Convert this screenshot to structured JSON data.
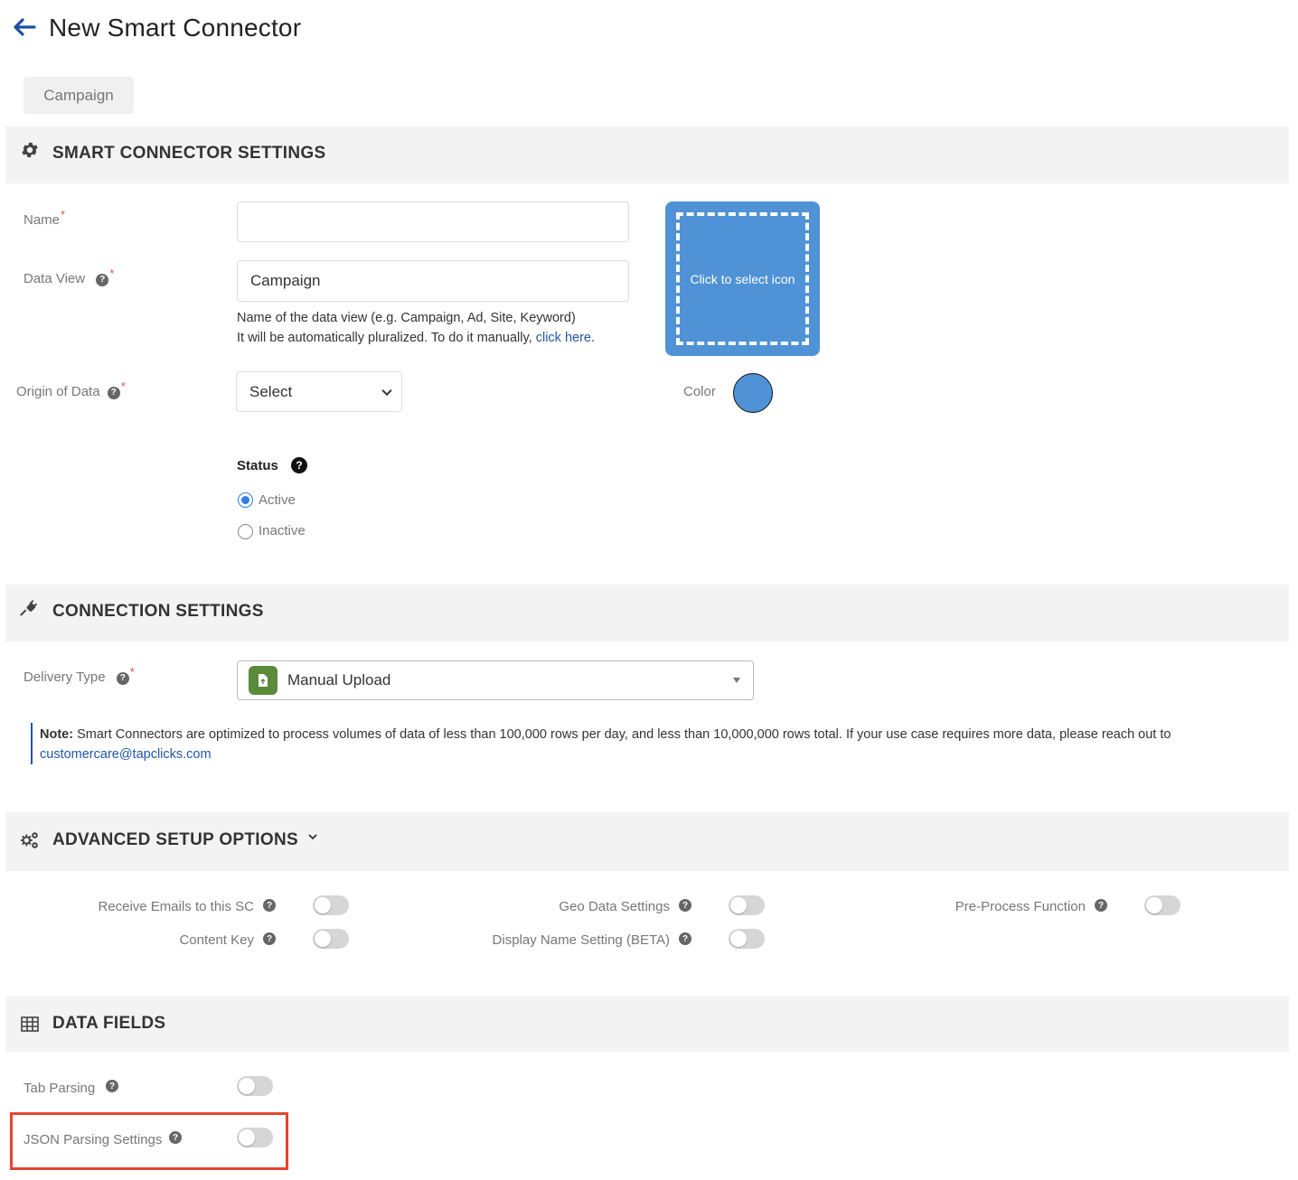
{
  "header": {
    "title": "New Smart Connector"
  },
  "tabs": [
    {
      "label": "Campaign"
    }
  ],
  "smart_connector_settings": {
    "section_title": "SMART CONNECTOR SETTINGS",
    "name_label": "Name",
    "name_value": "",
    "data_view_label": "Data View",
    "data_view_value": "Campaign",
    "data_view_hint_line1": "Name of the data view (e.g. Campaign, Ad, Site, Keyword)",
    "data_view_hint_line2": "It will be automatically pluralized. To do it manually,",
    "data_view_hint_link": "click here",
    "data_view_hint_end": ".",
    "origin_label": "Origin of Data",
    "origin_value": "Select",
    "icon_picker_text": "Click to select icon",
    "color_label": "Color",
    "color_value": "#4f92d6",
    "status_label": "Status",
    "status_options": [
      {
        "label": "Active",
        "checked": true
      },
      {
        "label": "Inactive",
        "checked": false
      }
    ]
  },
  "connection_settings": {
    "section_title": "CONNECTION SETTINGS",
    "delivery_type_label": "Delivery Type",
    "delivery_type_value": "Manual Upload",
    "note_label": "Note:",
    "note_text": "Smart Connectors are optimized to process volumes of data of less than 100,000 rows per day, and less than 10,000,000 rows total. If your use case requires more data, please reach out to",
    "note_email": "customercare@tapclicks.com"
  },
  "advanced_setup": {
    "section_title": "ADVANCED SETUP OPTIONS",
    "options": [
      {
        "label": "Receive Emails to this SC",
        "enabled": false
      },
      {
        "label": "Geo Data Settings",
        "enabled": false
      },
      {
        "label": "Pre-Process Function",
        "enabled": false
      },
      {
        "label": "Content Key",
        "enabled": false
      },
      {
        "label": "Display Name Setting (BETA)",
        "enabled": false
      }
    ]
  },
  "data_fields": {
    "section_title": "DATA FIELDS",
    "options": [
      {
        "label": "Tab Parsing",
        "enabled": false
      },
      {
        "label": "JSON Parsing Settings",
        "enabled": false
      }
    ]
  },
  "colors": {
    "accent": "#4f92d6",
    "link": "#2255aa",
    "required": "#d9534f",
    "highlight": "#e8432e",
    "delivery_icon": "#5a8a3a"
  },
  "icons": {
    "back": "arrow-left-icon",
    "settings": "gear-icon",
    "connection": "plug-icon",
    "advanced": "gears-icon",
    "data_fields": "table-icon",
    "help": "question-circle-icon",
    "delivery": "upload-file-icon"
  }
}
